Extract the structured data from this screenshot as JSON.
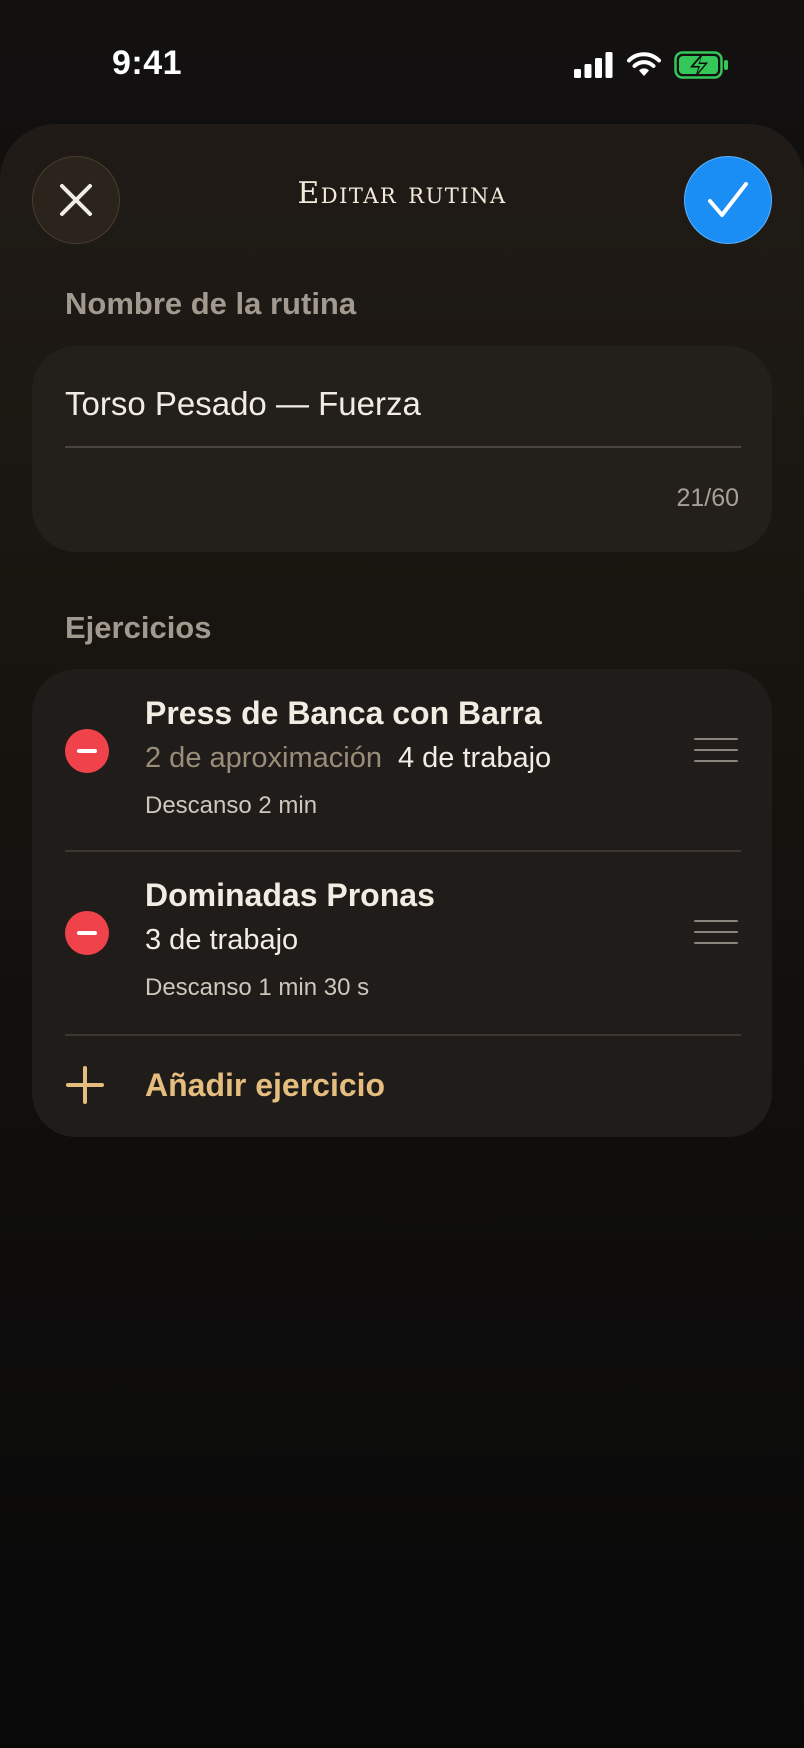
{
  "status_bar": {
    "time": "9:41"
  },
  "header": {
    "title": "Editar rutina"
  },
  "routine_name": {
    "label": "Nombre de la rutina",
    "value": "Torso Pesado — Fuerza",
    "char_count": "21/60"
  },
  "exercises": {
    "label": "Ejercicios",
    "items": [
      {
        "name": "Press de Banca con Barra",
        "warmup": "2 de aproximación",
        "work": "4 de trabajo",
        "rest": "Descanso 2 min"
      },
      {
        "name": "Dominadas Pronas",
        "warmup": "",
        "work": "3 de trabajo",
        "rest": "Descanso 1 min 30 s"
      }
    ],
    "add_label": "Añadir ejercicio"
  },
  "colors": {
    "accent_gold": "#e5bd7e",
    "confirm_blue": "#1a8ef5",
    "remove_red": "#f0424a",
    "battery_green": "#34c759"
  },
  "icons": [
    "close-icon",
    "checkmark-icon",
    "remove-icon",
    "drag-handle-icon",
    "plus-icon",
    "signal-icon",
    "wifi-icon",
    "battery-charging-icon"
  ]
}
